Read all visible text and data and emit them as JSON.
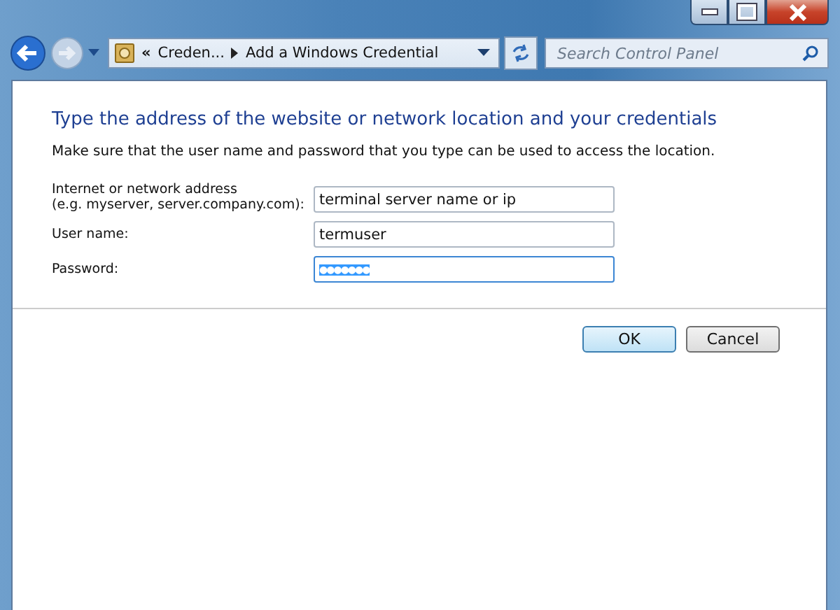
{
  "window": {
    "controls": [
      {
        "kind": "minimize"
      },
      {
        "kind": "maximize"
      },
      {
        "kind": "close"
      }
    ]
  },
  "address_bar": {
    "breadcrumbs": [
      "Creden...",
      "Add a Windows Credential"
    ],
    "overflow": "«"
  },
  "search": {
    "placeholder": "Search Control Panel"
  },
  "heading": "Type the address of the website or network location and your credentials",
  "description": "Make sure that the user name and password that you type can be used to access the location.",
  "fields": [
    {
      "label": "Internet or network address\n(e.g. myserver, server.company.com):",
      "value": "terminal server name or ip",
      "focused": false,
      "highlighted": false
    },
    {
      "label": "User name:",
      "value": "termuser",
      "focused": false,
      "highlighted": false
    },
    {
      "label": "Password:",
      "value": "●●●●●●●",
      "focused": true,
      "highlighted": true
    }
  ],
  "buttons": [
    {
      "label": "OK",
      "default": true
    },
    {
      "label": "Cancel",
      "default": false
    }
  ]
}
